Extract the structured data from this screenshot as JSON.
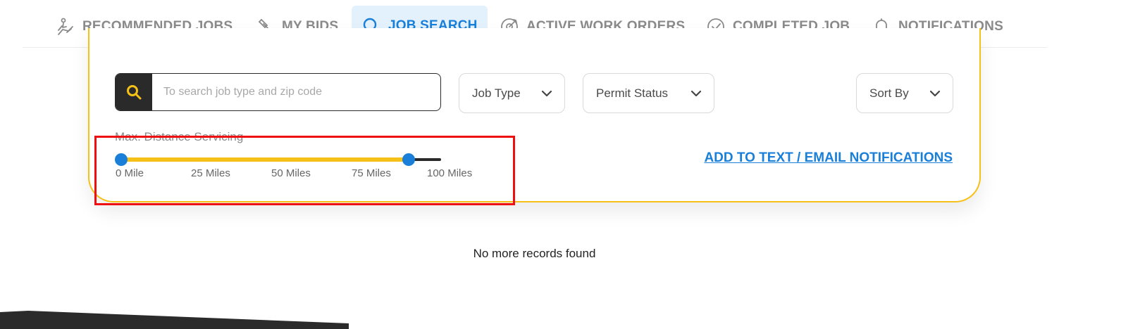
{
  "tabs": [
    {
      "label": "RECOMMENDED JOBS",
      "icon": "hand-icon"
    },
    {
      "label": "MY BIDS",
      "icon": "gavel-icon"
    },
    {
      "label": "JOB SEARCH",
      "icon": "search-icon",
      "active": true
    },
    {
      "label": "ACTIVE WORK ORDERS",
      "icon": "target-icon"
    },
    {
      "label": "COMPLETED JOB",
      "icon": "check-circle-icon"
    },
    {
      "label": "NOTIFICATIONS",
      "icon": "bell-icon"
    }
  ],
  "search": {
    "placeholder": "To search job type and zip code",
    "value": ""
  },
  "filters": {
    "job_type": "Job Type",
    "permit_status": "Permit Status",
    "sort_by": "Sort By"
  },
  "distance": {
    "label": "Max. Distance Servicing",
    "min_miles": 0,
    "max_miles": 100,
    "selected_low_miles": 0,
    "selected_high_miles": 90,
    "ticks": [
      "0 Mile",
      "25 Miles",
      "50 Miles",
      "75 Miles",
      "100 Miles"
    ]
  },
  "notify_link": "ADD TO TEXT / EMAIL NOTIFICATIONS",
  "empty_message": "No more records found",
  "colors": {
    "accent_blue": "#1a7fd8",
    "accent_yellow": "#f5c118",
    "dark": "#2a2a2a",
    "highlight_red": "#ee1010"
  }
}
